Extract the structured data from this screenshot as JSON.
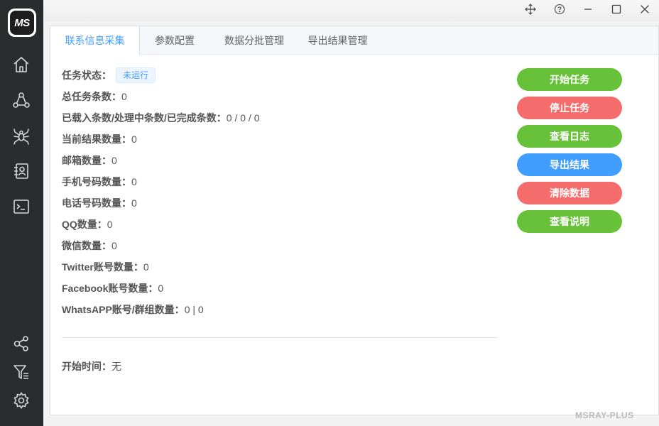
{
  "app": {
    "logo_text": "MS"
  },
  "sidebar": {
    "items": [
      {
        "icon": "home-icon"
      },
      {
        "icon": "network-icon"
      },
      {
        "icon": "spider-icon"
      },
      {
        "icon": "contacts-icon"
      },
      {
        "icon": "terminal-icon"
      },
      {
        "icon": "share-nodes-icon"
      },
      {
        "icon": "filter-list-icon"
      },
      {
        "icon": "settings-icon"
      }
    ]
  },
  "window_controls": {
    "icons": [
      "move-icon",
      "help-icon",
      "minimize-icon",
      "maximize-icon",
      "close-icon"
    ]
  },
  "tabs": [
    {
      "label": "联系信息采集",
      "active": true
    },
    {
      "label": "参数配置",
      "active": false
    },
    {
      "label": "数据分批管理",
      "active": false
    },
    {
      "label": "导出结果管理",
      "active": false
    }
  ],
  "status": {
    "label": "任务状态：",
    "value": "未运行"
  },
  "stats": [
    {
      "label": "总任务条数：",
      "value": "0"
    },
    {
      "label": "已载入条数/处理中条数/已完成条数：",
      "value": "0 / 0 / 0"
    },
    {
      "label": "当前结果数量：",
      "value": "0"
    },
    {
      "label": "邮箱数量：",
      "value": "0"
    },
    {
      "label": "手机号码数量：",
      "value": "0"
    },
    {
      "label": "电话号码数量：",
      "value": "0"
    },
    {
      "label": "QQ数量：",
      "value": "0"
    },
    {
      "label": "微信数量：",
      "value": "0"
    },
    {
      "label": "Twitter账号数量：",
      "value": "0"
    },
    {
      "label": "Facebook账号数量：",
      "value": "0"
    },
    {
      "label": "WhatsAPP账号/群组数量：",
      "value": "0 | 0"
    }
  ],
  "start_time": {
    "label": "开始时间：",
    "value": "无"
  },
  "actions": [
    {
      "label": "开始任务",
      "color": "#67c23a"
    },
    {
      "label": "停止任务",
      "color": "#f56c6c"
    },
    {
      "label": "查看日志",
      "color": "#67c23a"
    },
    {
      "label": "导出结果",
      "color": "#409eff"
    },
    {
      "label": "清除数据",
      "color": "#f56c6c"
    },
    {
      "label": "查看说明",
      "color": "#67c23a"
    }
  ],
  "watermark": "MSRAY-PLUS"
}
